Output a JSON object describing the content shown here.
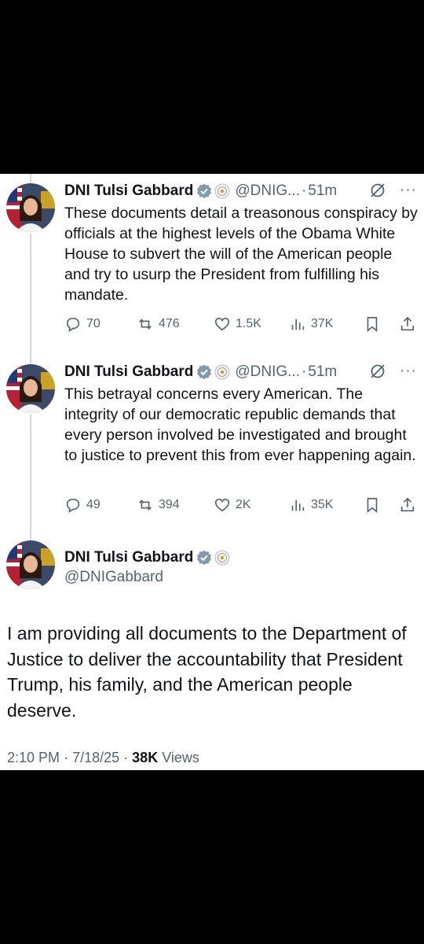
{
  "tweets": [
    {
      "name": "DNI Tulsi Gabbard",
      "handle": "@DNIG...",
      "dot": "·",
      "time": "51m",
      "more": "···",
      "text": "These documents detail a treasonous conspiracy by officials at the highest levels of the Obama White House to subvert the will of the American people and try to usurp the President from fulfilling his mandate.",
      "replies": "70",
      "reposts": "476",
      "likes": "1.5K",
      "views": "37K"
    },
    {
      "name": "DNI Tulsi Gabbard",
      "handle": "@DNIG...",
      "dot": "·",
      "time": "51m",
      "more": "···",
      "text": "This betrayal concerns every American. The integrity of our democratic republic demands that every person involved be investigated and brought to justice to prevent this from ever happening again.",
      "replies": "49",
      "reposts": "394",
      "likes": "2K",
      "views": "35K"
    }
  ],
  "main": {
    "name": "DNI Tulsi Gabbard",
    "handle": "@DNIGabbard",
    "text": "I am providing all documents to the Department of Justice to deliver the accountability that President Trump, his family, and the American people deserve.",
    "time": "2:10 PM",
    "date": "7/18/25",
    "sep": "·",
    "views_count": "38K",
    "views_label": "Views"
  },
  "colors": {
    "verified": "#829aab",
    "muted": "#536471",
    "text": "#0f1419",
    "thread_line": "#cfd9de"
  },
  "icons": [
    "reply-icon",
    "repost-icon",
    "like-icon",
    "views-icon",
    "bookmark-icon",
    "share-icon",
    "grok-icon",
    "more-icon",
    "verified-badge-icon",
    "government-seal-icon"
  ]
}
